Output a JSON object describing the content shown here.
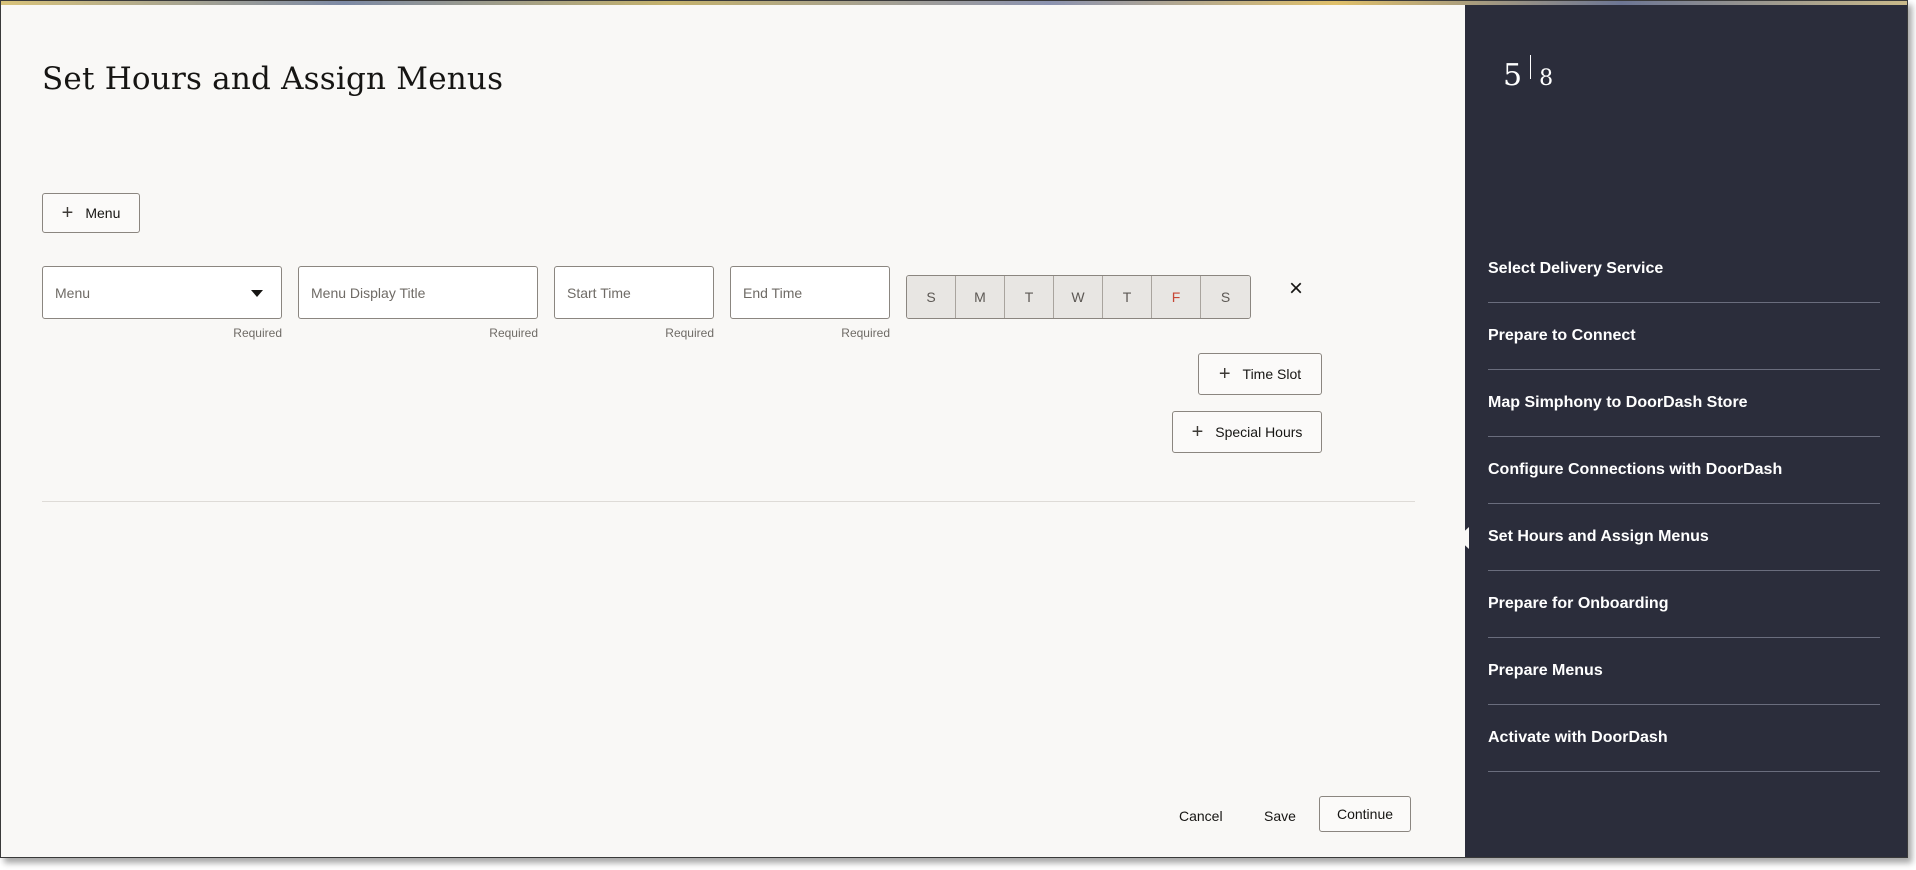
{
  "page": {
    "title": "Set Hours and Assign Menus",
    "add_menu_label": "Menu"
  },
  "row": {
    "menu_select": {
      "placeholder": "Menu",
      "helper": "Required"
    },
    "display_title": {
      "placeholder": "Menu Display Title",
      "helper": "Required"
    },
    "start_time": {
      "placeholder": "Start Time",
      "helper": "Required"
    },
    "end_time": {
      "placeholder": "End Time",
      "helper": "Required"
    },
    "days": [
      "S",
      "M",
      "T",
      "W",
      "T",
      "F",
      "S"
    ],
    "remove_icon": "close-icon",
    "time_slot_label": "Time Slot",
    "special_hours_label": "Special Hours"
  },
  "footer": {
    "cancel": "Cancel",
    "save": "Save",
    "continue": "Continue"
  },
  "sidebar": {
    "current_step": "5",
    "total_steps": "8",
    "steps": [
      {
        "label": "Select Delivery Service",
        "active": false
      },
      {
        "label": "Prepare to Connect",
        "active": false
      },
      {
        "label": "Map Simphony to DoorDash Store",
        "active": false
      },
      {
        "label": "Configure Connections with DoorDash",
        "active": false
      },
      {
        "label": "Set Hours and Assign Menus",
        "active": true
      },
      {
        "label": "Prepare for Onboarding",
        "active": false
      },
      {
        "label": "Prepare Menus",
        "active": false
      },
      {
        "label": "Activate with DoorDash",
        "active": false
      }
    ]
  },
  "colors": {
    "sidebar_bg": "#2b2d3b",
    "page_bg": "#f9f8f6",
    "friday_red": "#c74634"
  }
}
